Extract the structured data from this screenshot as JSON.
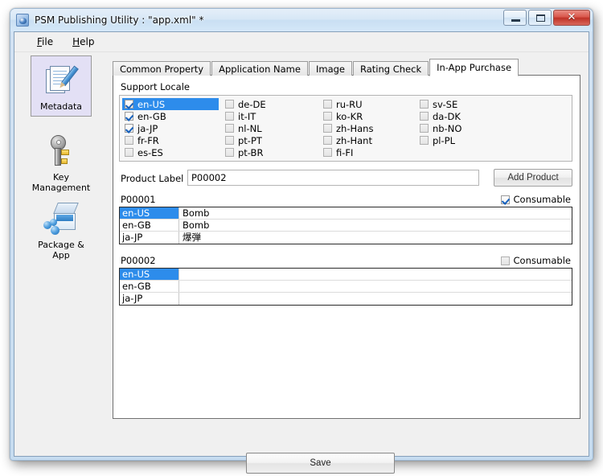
{
  "window": {
    "title": "PSM Publishing Utility : \"app.xml\" *",
    "app_icon": "psm-app-icon",
    "minimize_label": "Minimize",
    "maximize_label": "Maximize",
    "close_label": "✕"
  },
  "menu": {
    "items": [
      {
        "label": "File",
        "mnemonic": "F"
      },
      {
        "label": "Help",
        "mnemonic": "H"
      }
    ]
  },
  "sidebar": {
    "items": [
      {
        "label": "Metadata",
        "icon": "document-pencil-icon",
        "selected": true
      },
      {
        "label": "Key\nManagement",
        "line1": "Key",
        "line2": "Management",
        "icon": "key-icon",
        "selected": false
      },
      {
        "label": "Package & App",
        "line1": "Package &",
        "line2": "App",
        "icon": "package-box-icon",
        "selected": false
      }
    ]
  },
  "tabs": [
    {
      "label": "Common Property",
      "active": false
    },
    {
      "label": "Application Name",
      "active": false
    },
    {
      "label": "Image",
      "active": false
    },
    {
      "label": "Rating Check",
      "active": false
    },
    {
      "label": "In-App Purchase",
      "active": true
    }
  ],
  "support_locale": {
    "label": "Support Locale",
    "columns": [
      [
        {
          "code": "en-US",
          "checked": true,
          "selected": true
        },
        {
          "code": "en-GB",
          "checked": true,
          "selected": false
        },
        {
          "code": "ja-JP",
          "checked": true,
          "selected": false
        },
        {
          "code": "fr-FR",
          "checked": false,
          "selected": false
        },
        {
          "code": "es-ES",
          "checked": false,
          "selected": false
        }
      ],
      [
        {
          "code": "de-DE",
          "checked": false,
          "selected": false
        },
        {
          "code": "it-IT",
          "checked": false,
          "selected": false
        },
        {
          "code": "nl-NL",
          "checked": false,
          "selected": false
        },
        {
          "code": "pt-PT",
          "checked": false,
          "selected": false
        },
        {
          "code": "pt-BR",
          "checked": false,
          "selected": false
        }
      ],
      [
        {
          "code": "ru-RU",
          "checked": false,
          "selected": false
        },
        {
          "code": "ko-KR",
          "checked": false,
          "selected": false
        },
        {
          "code": "zh-Hans",
          "checked": false,
          "selected": false
        },
        {
          "code": "zh-Hant",
          "checked": false,
          "selected": false
        },
        {
          "code": "fi-FI",
          "checked": false,
          "selected": false
        }
      ],
      [
        {
          "code": "sv-SE",
          "checked": false,
          "selected": false
        },
        {
          "code": "da-DK",
          "checked": false,
          "selected": false
        },
        {
          "code": "nb-NO",
          "checked": false,
          "selected": false
        },
        {
          "code": "pl-PL",
          "checked": false,
          "selected": false
        }
      ]
    ]
  },
  "product_form": {
    "label": "Product Label",
    "value": "P00002",
    "placeholder": "",
    "add_button": "Add Product"
  },
  "products": [
    {
      "id": "P00001",
      "consumable_label": "Consumable",
      "consumable_checked": true,
      "rows": [
        {
          "locale": "en-US",
          "name": "Bomb",
          "selected": true
        },
        {
          "locale": "en-GB",
          "name": "Bomb",
          "selected": false
        },
        {
          "locale": "ja-JP",
          "name": "爆弾",
          "selected": false
        }
      ]
    },
    {
      "id": "P00002",
      "consumable_label": "Consumable",
      "consumable_checked": false,
      "rows": [
        {
          "locale": "en-US",
          "name": "",
          "selected": true
        },
        {
          "locale": "en-GB",
          "name": "",
          "selected": false
        },
        {
          "locale": "ja-JP",
          "name": "",
          "selected": false
        }
      ]
    }
  ],
  "footer": {
    "save_label": "Save"
  },
  "colors": {
    "selection_blue": "#2d8ceb",
    "frame_blue": "#c6dcf0",
    "sidebar_selected": "#e3e0f5",
    "close_red": "#bf3227"
  }
}
